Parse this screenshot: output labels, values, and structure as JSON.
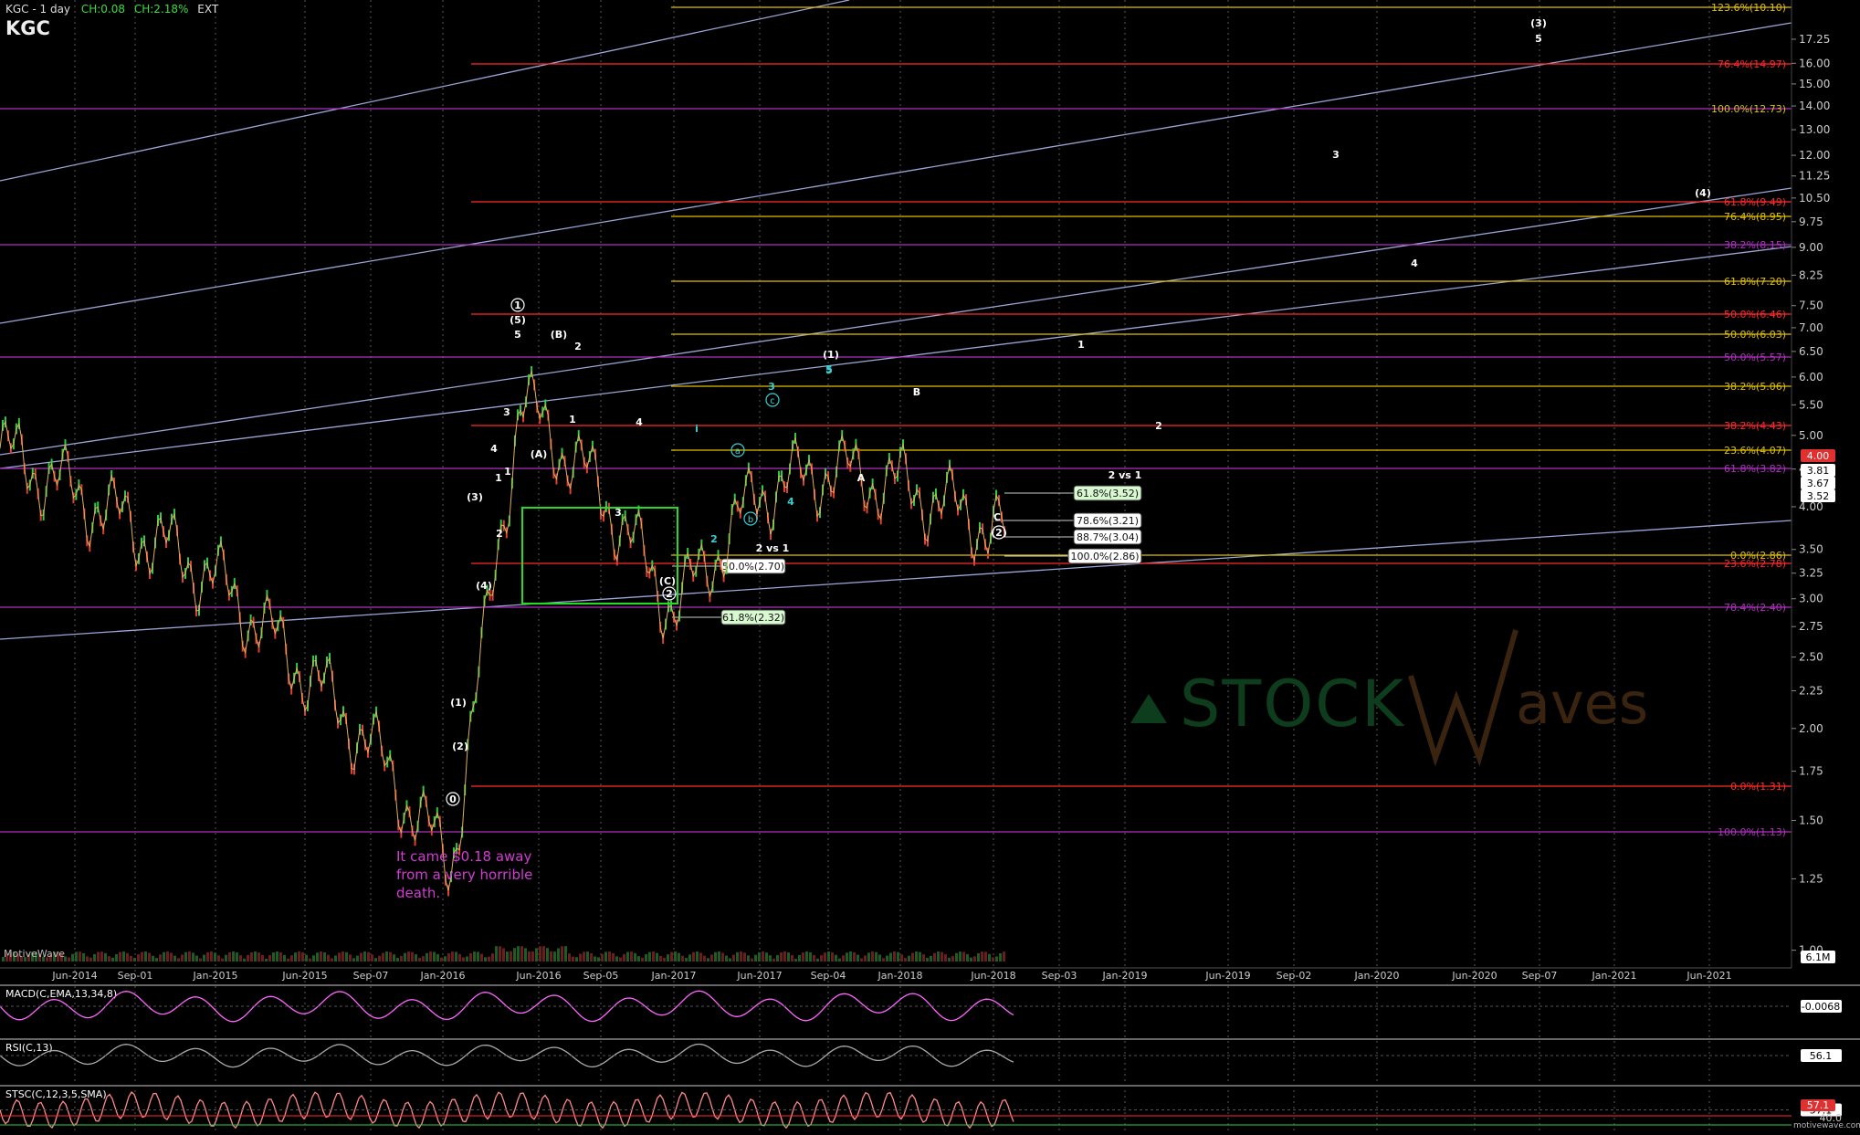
{
  "header": {
    "symbol_timeframe": "KGC - 1 day",
    "symbol": "KGC",
    "change": "CH:0.08",
    "change_pct": "CH:2.18%",
    "session": "EXT"
  },
  "annotation_note": [
    "It came $0.18 away",
    "from a very horrible",
    "death."
  ],
  "watermark": {
    "brand": "STOCK",
    "brand2": "aves"
  },
  "footer": {
    "left_brand": "MotiveWave",
    "right_brand": "motivewave.com"
  },
  "x_axis_labels": [
    "Jun-2014",
    "Sep-01",
    "Jan-2015",
    "Jun-2015",
    "Sep-07",
    "Jan-2016",
    "Jun-2016",
    "Sep-05",
    "Jan-2017",
    "Jun-2017",
    "Sep-04",
    "Jan-2018",
    "Jun-2018",
    "Sep-03",
    "Jan-2019",
    "Jun-2019",
    "Sep-02",
    "Jan-2020",
    "Jun-2020",
    "Sep-07",
    "Jan-2021",
    "Jun-2021"
  ],
  "price_axis_ticks": [
    "17.25",
    "16.00",
    "15.00",
    "14.00",
    "13.00",
    "12.00",
    "11.25",
    "10.50",
    "9.75",
    "9.00",
    "8.25",
    "7.50",
    "7.00",
    "6.50",
    "6.00",
    "5.50",
    "5.00",
    "4.50",
    "4.00",
    "3.50",
    "3.25",
    "3.00",
    "2.75",
    "2.50",
    "2.25",
    "2.00",
    "1.75",
    "1.50",
    "1.25",
    "1.00"
  ],
  "price_badges": {
    "last": "4.00",
    "b1": "3.81",
    "b2": "3.67",
    "b3": "3.52",
    "volume": "6.1M"
  },
  "fib_labels_right": [
    {
      "text": "123.6%(10.10)",
      "color": "#e0c000"
    },
    {
      "text": "76.4%(14.97)",
      "color": "#ff2a2a"
    },
    {
      "text": "100.0%(12.73)",
      "color": "#e0c000"
    },
    {
      "text": "61.8%(9.49)",
      "color": "#ff2a2a"
    },
    {
      "text": "76.4%(8.95)",
      "color": "#e0c000"
    },
    {
      "text": "38.2%(8.15)",
      "color": "#b030c0"
    },
    {
      "text": "61.8%(7.20)",
      "color": "#e0c000"
    },
    {
      "text": "50.0%(6.46)",
      "color": "#ff2a2a"
    },
    {
      "text": "50.0%(6.03)",
      "color": "#e0c000"
    },
    {
      "text": "50.0%(5.57)",
      "color": "#b030c0"
    },
    {
      "text": "38.2%(5.06)",
      "color": "#e0c000"
    },
    {
      "text": "38.2%(4.43)",
      "color": "#ff2a2a"
    },
    {
      "text": "23.6%(4.07)",
      "color": "#e0c000"
    },
    {
      "text": "61.8%(3.82)",
      "color": "#b030c0"
    },
    {
      "text": "0.0%(2.86)",
      "color": "#e0c000"
    },
    {
      "text": "23.6%(2.78)",
      "color": "#ff2a2a"
    },
    {
      "text": "78.4%(2.40)",
      "color": "#b030c0"
    },
    {
      "text": "0.0%(1.31)",
      "color": "#ff2a2a"
    },
    {
      "text": "100.0%(1.13)",
      "color": "#b030c0"
    }
  ],
  "fib_boxes": [
    {
      "text": "61.8%(3.52)",
      "fill": "#d8f8d0"
    },
    {
      "text": "78.6%(3.21)",
      "fill": "#ffffff"
    },
    {
      "text": "88.7%(3.04)",
      "fill": "#ffffff"
    },
    {
      "text": "100.0%(2.86)",
      "fill": "#ffffff"
    },
    {
      "text": "50.0%(2.70)",
      "fill": "#ffffff"
    },
    {
      "text": "61.8%(2.32)",
      "fill": "#d8f8d0"
    }
  ],
  "wave_labels": {
    "w1circ": "1",
    "w5par": "(5)",
    "w5a": "5",
    "wB": "(B)",
    "w2a": "2",
    "w3a": "3",
    "w1a": "1",
    "wA": "(A)",
    "w1b": "1",
    "w4a": "4",
    "w3par": "(3)",
    "w1c": "1",
    "w2b": "2",
    "w4par": "(4)",
    "w1par": "(1)",
    "w2par": "(2)",
    "w0circ": "0",
    "w3b": "3",
    "w4b": "4",
    "wCpar": "(C)",
    "w2circ": "2",
    "w2vs1a": "2 vs 1",
    "cyan_i": "i",
    "cyan_2": "2",
    "cyan_3": "3",
    "cyan_4": "4",
    "cyan_5": "5",
    "cyan_a": "a",
    "cyan_b": "b",
    "cyan_c": "c",
    "wPar1": "(1)",
    "w5b": "5",
    "wBb": "B",
    "wAb": "A",
    "wCb": "C",
    "wPar2b": "(2)",
    "w2vs1b": "2 vs 1",
    "f3par": "(3)",
    "f5": "5",
    "f3": "3",
    "f4par": "(4)",
    "f4": "4",
    "f1": "1",
    "f2": "2"
  },
  "indicators": {
    "macd": {
      "label": "MACD(C,EMA,13,34,8)",
      "value": "-0.0068"
    },
    "rsi": {
      "label": "RSI(C,13)",
      "value": "56.1"
    },
    "stoch": {
      "label": "STSC(C,12,3,5,SMA)",
      "value": "57.1",
      "value2": "40.0"
    }
  },
  "chart_data": {
    "type": "line",
    "title": "KGC - 1 day",
    "ylabel": "",
    "y_scale": "log",
    "ylim": [
      0.85,
      18.5
    ],
    "x": [
      "Jun-2014",
      "Sep-2014",
      "Jan-2015",
      "Jun-2015",
      "Sep-2015",
      "Jan-2016",
      "Jun-2016",
      "Sep-2016",
      "Jan-2017",
      "Jun-2017",
      "Sep-2017",
      "Jan-2018",
      "Jun-2018"
    ],
    "series": [
      {
        "values": [
          4.8,
          3.8,
          3.2,
          2.4,
          1.9,
          1.3,
          5.6,
          4.2,
          2.9,
          4.2,
          4.5,
          4.3,
          3.7
        ]
      }
    ],
    "legend": "none",
    "grid": true
  }
}
